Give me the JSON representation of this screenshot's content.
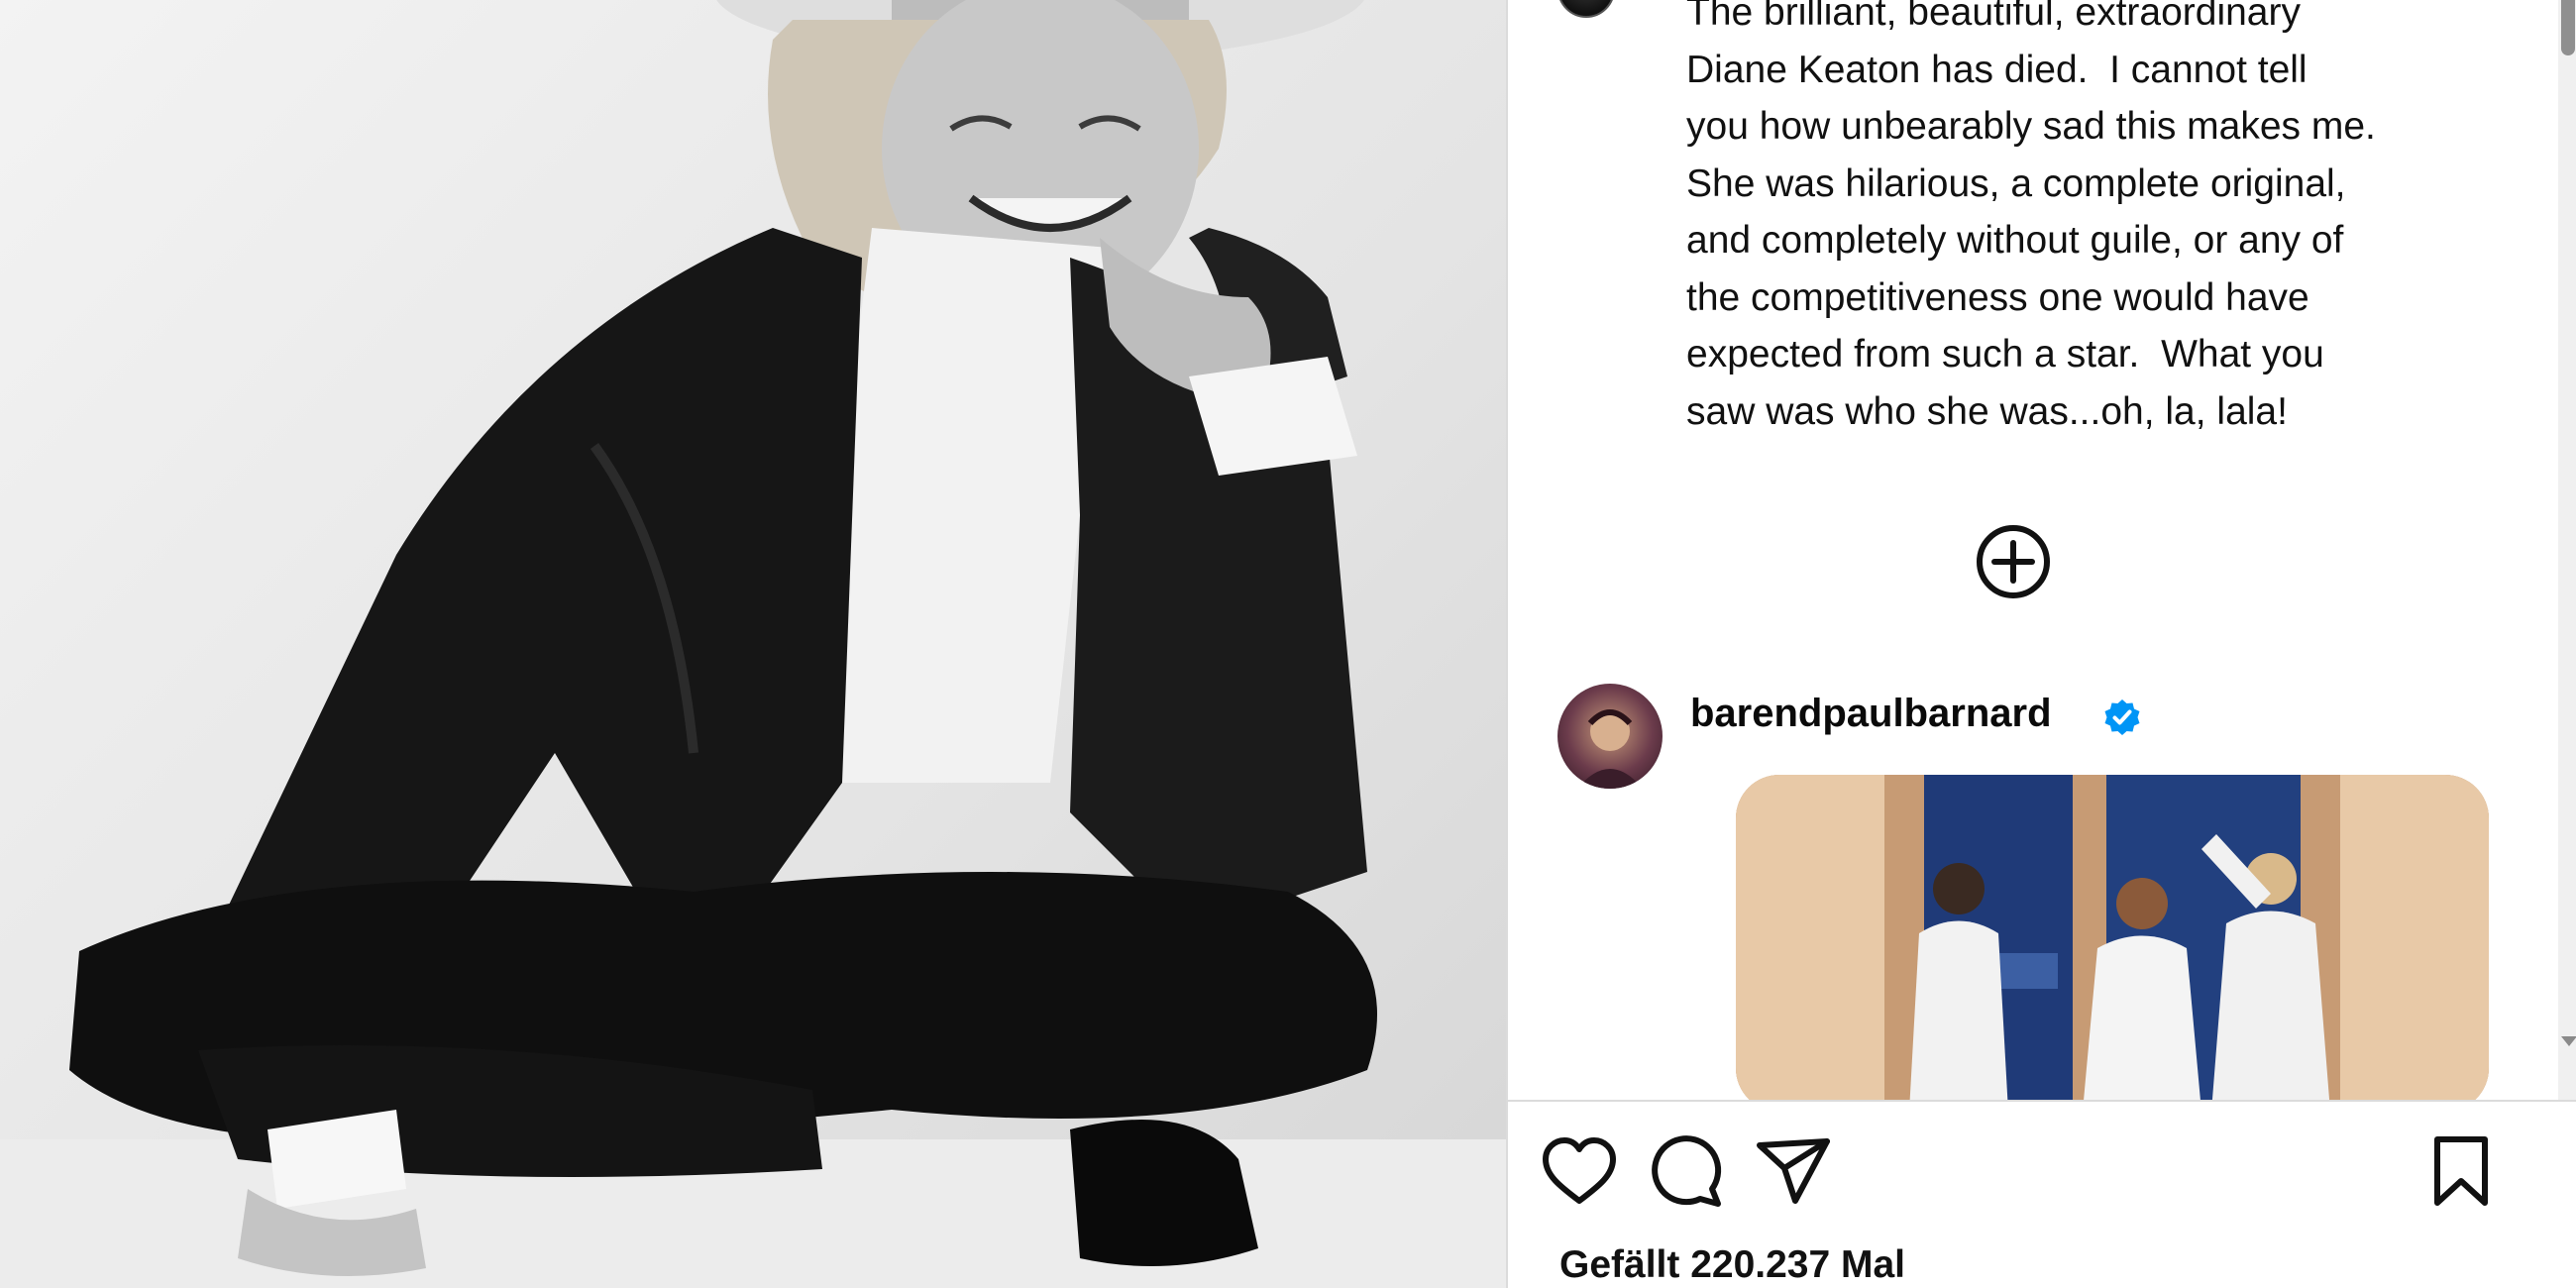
{
  "post": {
    "caption": "The brilliant, beautiful, extraordinary\nDiane Keaton has died.  I cannot tell\nyou how unbearably sad this makes me.\nShe was hilarious, a complete original,\nand completely without guile, or any of\nthe competitiveness one would have\nexpected from such a star.  What you\nsaw was who she was...oh, la, lala!",
    "likes_text": "Gefällt 220.237 Mal"
  },
  "comments": [
    {
      "username": "barendpaulbarnard",
      "verified": true
    }
  ],
  "icons": {
    "load_more": "plus-circle-icon",
    "like": "heart-icon",
    "comment": "speech-bubble-icon",
    "share": "paper-plane-icon",
    "save": "bookmark-icon",
    "verified": "verified-badge-icon"
  },
  "colors": {
    "verified": "#0095f6",
    "text": "#111111",
    "divider": "#dbdbdb"
  }
}
